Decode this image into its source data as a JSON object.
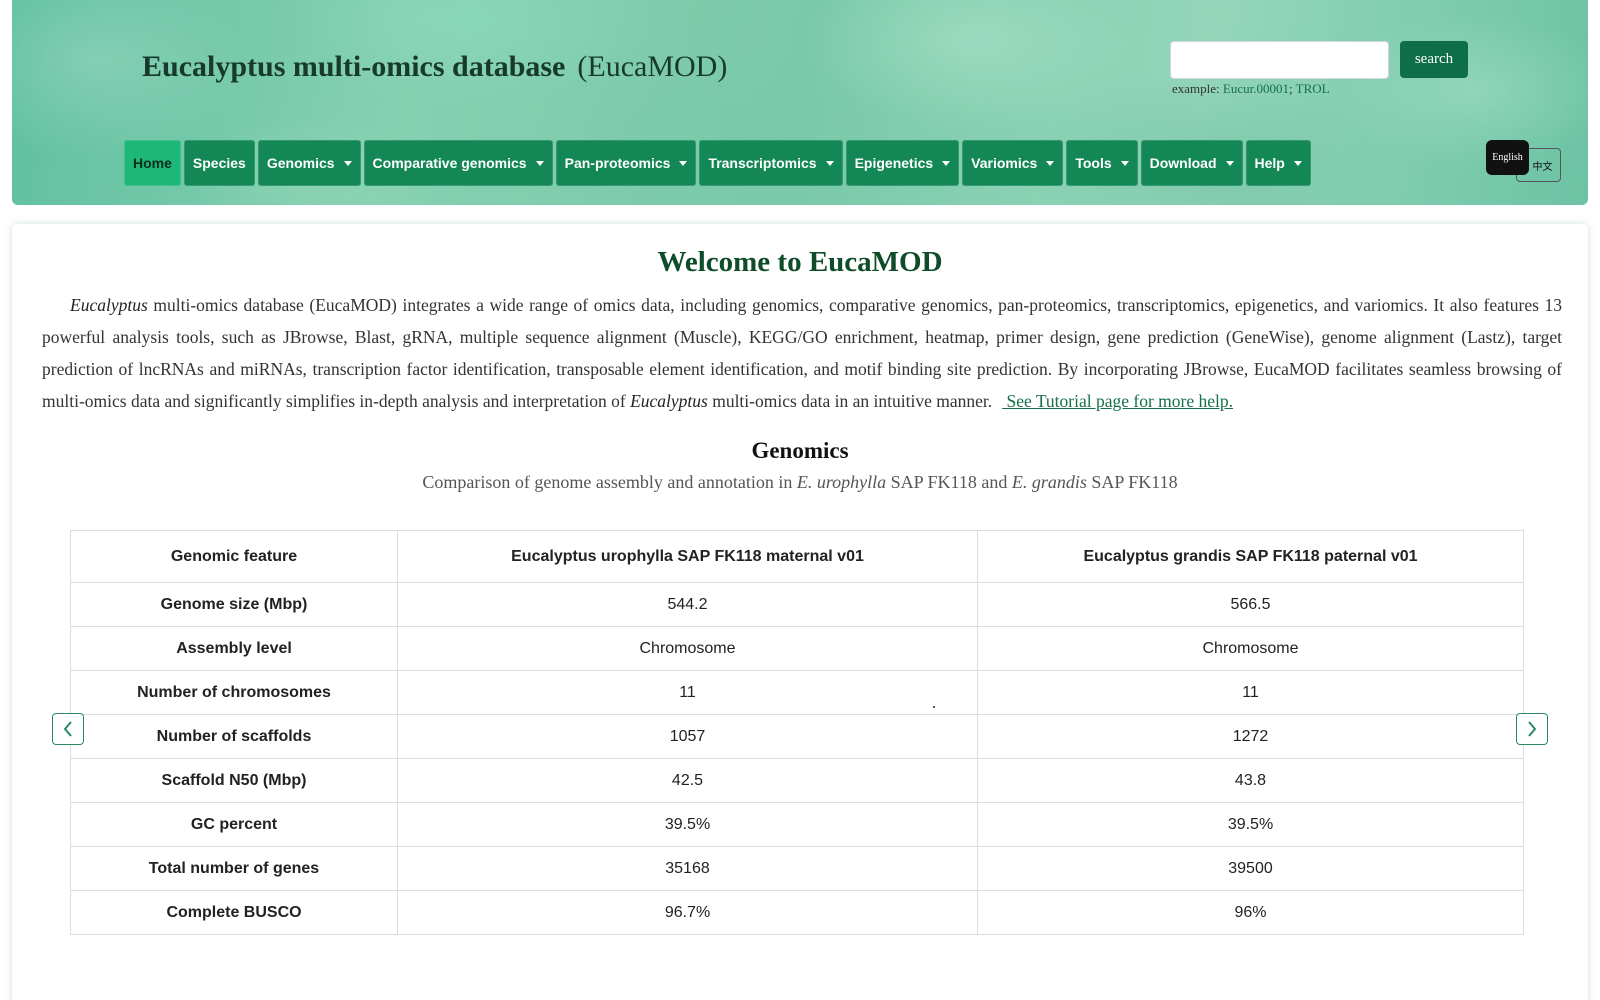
{
  "header": {
    "title_main": "Eucalyptus multi-omics database",
    "title_abbr": "(EucaMOD)",
    "search": {
      "placeholder": "",
      "value": "",
      "button_label": "search",
      "example_prefix": "example:",
      "example_1": "Eucur.00001",
      "example_sep": ";",
      "example_2": "TROL"
    },
    "lang_en": "English",
    "lang_zh": "中文"
  },
  "nav": [
    {
      "label": "Home",
      "dropdown": false,
      "active": true
    },
    {
      "label": "Species",
      "dropdown": false
    },
    {
      "label": "Genomics",
      "dropdown": true
    },
    {
      "label": "Comparative genomics",
      "dropdown": true
    },
    {
      "label": "Pan-proteomics",
      "dropdown": true
    },
    {
      "label": "Transcriptomics",
      "dropdown": true
    },
    {
      "label": "Epigenetics",
      "dropdown": true
    },
    {
      "label": "Variomics",
      "dropdown": true
    },
    {
      "label": "Tools",
      "dropdown": true
    },
    {
      "label": "Download",
      "dropdown": true
    },
    {
      "label": "Help",
      "dropdown": true
    }
  ],
  "welcome": {
    "title": "Welcome to EucaMOD",
    "intro_italic_1": "Eucalyptus",
    "intro_text_1": " multi-omics database (EucaMOD) integrates a wide range of omics data, including genomics, comparative genomics, pan-proteomics, transcriptomics, epigenetics, and variomics. It also features 13 powerful analysis tools, such as JBrowse, Blast, gRNA, multiple sequence alignment (Muscle), KEGG/GO enrichment, heatmap, primer design, gene prediction (GeneWise), genome alignment (Lastz), target prediction of lncRNAs and miRNAs, transcription factor identification, transposable element identification, and motif binding site prediction. By incorporating JBrowse, EucaMOD facilitates seamless browsing of multi-omics data and significantly simplifies in-depth analysis and interpretation of ",
    "intro_italic_2": "Eucalyptus",
    "intro_text_2": " multi-omics data in an intuitive manner.",
    "tutorial_link": " See Tutorial page for more help."
  },
  "genomics": {
    "title": "Genomics",
    "subtitle_1": "Comparison of genome assembly and annotation in ",
    "species_1": "E. urophylla",
    "subtitle_2": " SAP FK118 and ",
    "species_2": "E. grandis",
    "subtitle_3": " SAP FK118",
    "columns": [
      "Genomic feature",
      "Eucalyptus urophylla SAP FK118 maternal v01",
      "Eucalyptus grandis SAP FK118 paternal v01"
    ],
    "rows": [
      [
        "Genome size (Mbp)",
        "544.2",
        "566.5"
      ],
      [
        "Assembly level",
        "Chromosome",
        "Chromosome"
      ],
      [
        "Number of chromosomes",
        "11",
        "11"
      ],
      [
        "Number of scaffolds",
        "1057",
        "1272"
      ],
      [
        "Scaffold N50 (Mbp)",
        "42.5",
        "43.8"
      ],
      [
        "GC percent",
        "39.5%",
        "39.5%"
      ],
      [
        "Total number of genes",
        "35168",
        "39500"
      ],
      [
        "Complete BUSCO",
        "96.7%",
        "96%"
      ]
    ]
  },
  "colors": {
    "nav_bg": "#138856",
    "nav_active": "#1db877",
    "search_button": "#0e6e4a",
    "heading_green": "#0f4d2a",
    "link_green": "#16704a"
  }
}
